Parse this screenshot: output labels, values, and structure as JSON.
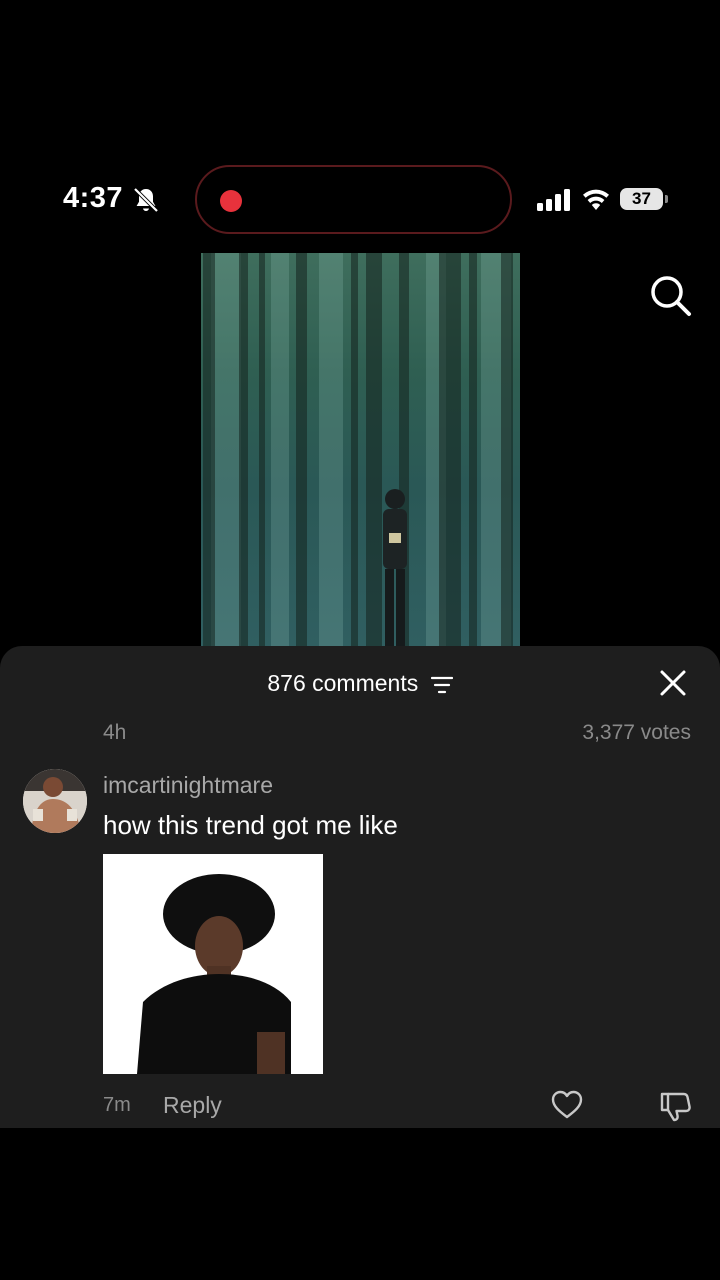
{
  "status_bar": {
    "time": "4:37",
    "battery": "37"
  },
  "icons": {
    "bell": "bell-slash-icon",
    "signal": "cellular-signal-icon",
    "wifi": "wifi-icon",
    "search": "search-icon",
    "close": "close-icon",
    "filter": "filter-icon",
    "like": "heart-icon",
    "dislike": "thumbs-down-icon"
  },
  "colors": {
    "recording": "#e8323c",
    "panel_bg": "#1e1e1e"
  },
  "comments_panel": {
    "title": "876 comments",
    "post_age": "4h",
    "votes": "3,377 votes",
    "comment": {
      "username": "imcartinightmare",
      "text": "how this trend got me like",
      "time": "7m",
      "reply_label": "Reply"
    }
  }
}
